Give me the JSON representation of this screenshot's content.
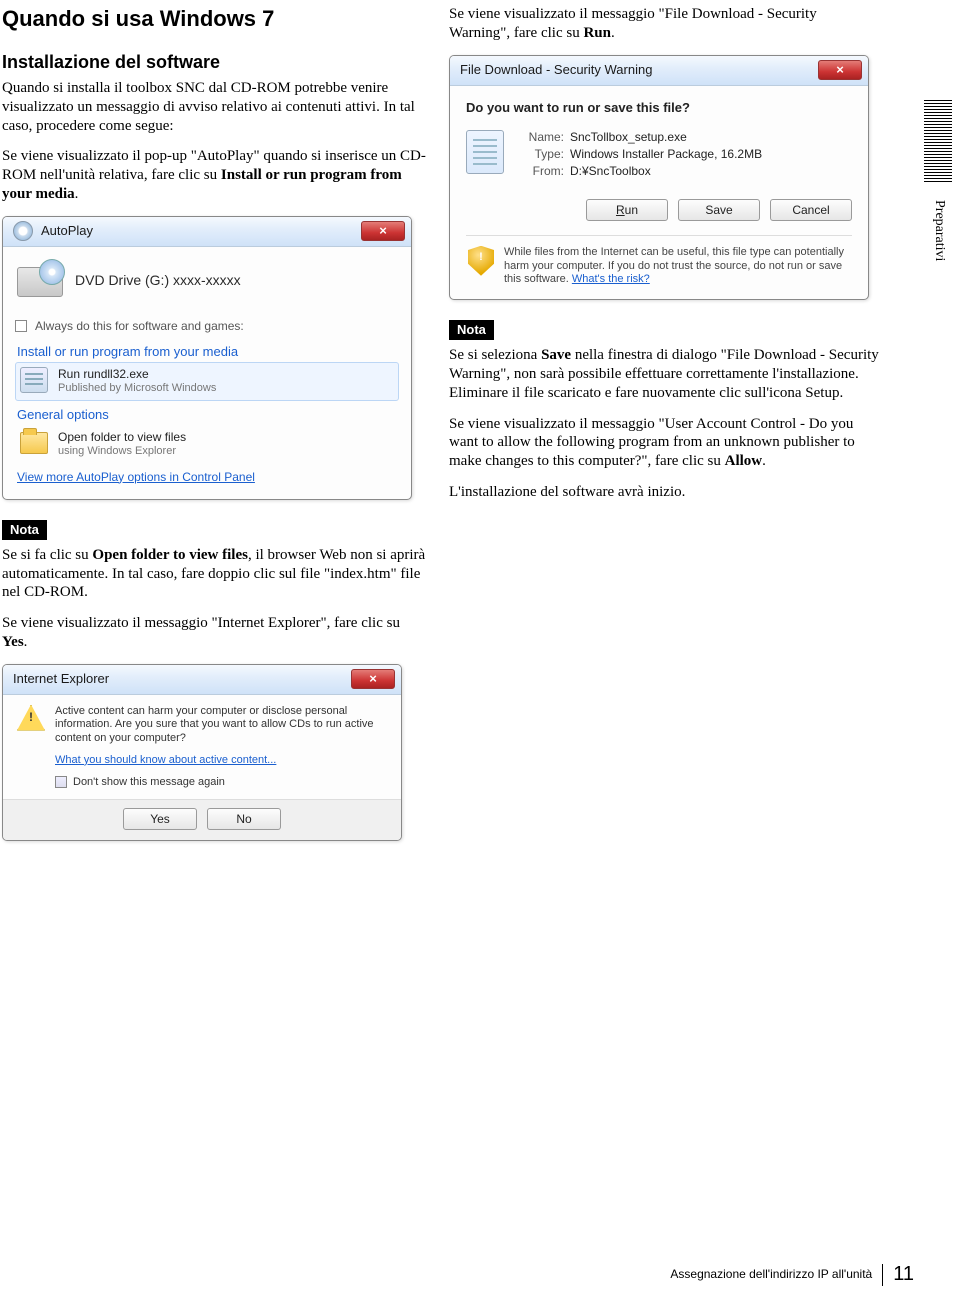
{
  "left": {
    "h2": "Quando si usa Windows 7",
    "h3": "Installazione del software",
    "p1": "Quando si installa il toolbox SNC dal CD-ROM potrebbe venire visualizzato un messaggio di avviso relativo ai contenuti attivi. In tal caso, procedere come segue:",
    "p2a": "Se viene visualizzato il pop-up \"AutoPlay\" quando si inserisce un CD-ROM nell'unità relativa, fare clic su ",
    "p2b": "Install or run program from your media",
    "nota_label": "Nota",
    "nota1a": "Se si fa clic su ",
    "nota1b": "Open folder to view files",
    "nota1c": ", il browser Web non si aprirà automaticamente. In tal caso, fare doppio clic sul file \"index.htm\" file nel CD-ROM.",
    "p3a": "Se viene visualizzato il messaggio \"Internet Explorer\", fare clic su ",
    "p3b": "Yes"
  },
  "autoplay": {
    "title": "AutoPlay",
    "drive": "DVD Drive (G:) xxxx-xxxxx",
    "always": "Always do this for software and games:",
    "head1": "Install or run program from your media",
    "run_line1": "Run rundll32.exe",
    "run_line2": "Published by Microsoft Windows",
    "head2": "General options",
    "open_line1": "Open folder to view files",
    "open_line2": "using Windows Explorer",
    "more": "View more AutoPlay options in Control Panel"
  },
  "ie": {
    "title": "Internet Explorer",
    "msg": "Active content can harm your computer or disclose personal information. Are you sure that you want to allow CDs to run active content on your computer?",
    "link": "What you should know about active content...",
    "chk": "Don't show this message again",
    "yes": "Yes",
    "no": "No"
  },
  "right": {
    "p1a": "Se viene visualizzato il messaggio \"File Download - Security Warning\", fare clic su ",
    "p1b": "Run",
    "nota_label": "Nota",
    "nota_a": "Se si seleziona ",
    "nota_b": "Save",
    "nota_c": " nella finestra di dialogo \"File Download - Security Warning\", non sarà possibile effettuare correttamente l'installazione. Eliminare il file scaricato e fare nuovamente clic sull'icona Setup.",
    "p2a": "Se viene visualizzato il messaggio \"User Account Control - Do you want to allow the following program from an unknown publisher to make changes to this computer?\", fare clic su ",
    "p2b": "Allow",
    "p3": "L'installazione del software avrà inizio."
  },
  "fd": {
    "title": "File Download - Security Warning",
    "q": "Do you want to run or save this file?",
    "name_l": "Name:",
    "name_v": "SncTollbox_setup.exe",
    "type_l": "Type:",
    "type_v": "Windows Installer Package, 16.2MB",
    "from_l": "From:",
    "from_v": "D:¥SncToolbox",
    "run": "Run",
    "save": "Save",
    "cancel": "Cancel",
    "warn": "While files from the Internet can be useful, this file type can potentially harm your computer. If you do not trust the source, do not run or save this software. ",
    "risk": "What's the risk?"
  },
  "side_tab": "Preparativi",
  "footer": {
    "txt": "Assegnazione dell'indirizzo IP all'unità",
    "page": "11"
  }
}
